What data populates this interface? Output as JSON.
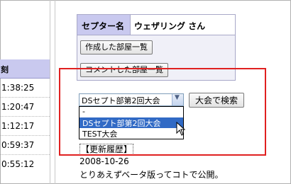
{
  "left_column": {
    "header": "刻",
    "times": [
      "1:38:25",
      "1:20:47",
      "1:12:17",
      "0:59:37",
      "0:55:12"
    ]
  },
  "user_panel": {
    "label": "セプター名",
    "name": "ウェザリング さん",
    "buttons": [
      "作成した部屋一覧",
      "コメントした部屋一覧"
    ]
  },
  "search": {
    "selected": "DSセプト部第2回大会",
    "button_label": "大会で検索",
    "options": [
      "-",
      "DSセプト部第2回大会",
      "TEST大会"
    ],
    "highlighted_index": 1
  },
  "updates": {
    "heading": "【更新履歴】",
    "date": "2008-10-26",
    "text": "とりあえずベータ版ってコトで公開。"
  },
  "colors": {
    "highlight_rect": "#e02020",
    "header_bg": "#c9c9ef",
    "selected_option": "#316ac5"
  }
}
